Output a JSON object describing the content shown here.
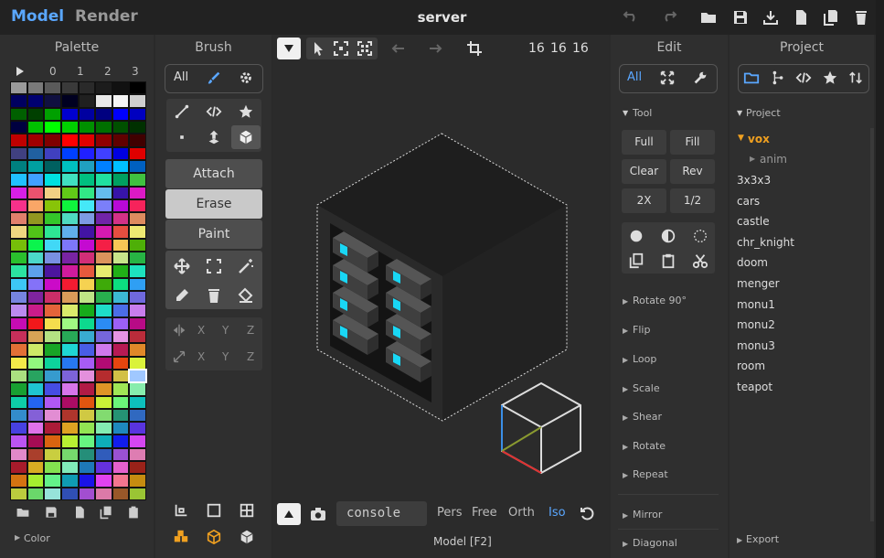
{
  "titlebar": {
    "mode_model": "Model",
    "mode_render": "Render",
    "title": "server"
  },
  "palette": {
    "header": "Palette",
    "columns": [
      "0",
      "1",
      "2",
      "3"
    ],
    "footer_label": "Color",
    "accent": "#5aa7ff"
  },
  "brush": {
    "header": "Brush",
    "all_label": "All",
    "attach_label": "Attach",
    "erase_label": "Erase",
    "paint_label": "Paint",
    "axis_labels": [
      "X",
      "Y",
      "Z"
    ]
  },
  "viewport": {
    "dims": [
      "16",
      "16",
      "16"
    ],
    "console_placeholder": "console",
    "modes": [
      "Pers",
      "Free",
      "Orth",
      "Iso"
    ],
    "active_mode": "Iso",
    "status": "Model [F2]"
  },
  "edit": {
    "header": "Edit",
    "all_label": "All",
    "tool_section": "Tool",
    "buttons": [
      "Full",
      "Fill",
      "Clear",
      "Rev",
      "2X",
      "1/2"
    ],
    "sections": [
      "Rotate 90°",
      "Flip",
      "Loop",
      "Scale",
      "Shear",
      "Rotate",
      "Repeat",
      "Mirror",
      "Diagonal"
    ]
  },
  "project": {
    "header": "Project",
    "section": "Project",
    "folder": "vox",
    "subfolder": "anim",
    "items": [
      "3x3x3",
      "cars",
      "castle",
      "chr_knight",
      "doom",
      "menger",
      "monu1",
      "monu2",
      "monu3",
      "room",
      "teapot"
    ],
    "footer": "Export"
  }
}
